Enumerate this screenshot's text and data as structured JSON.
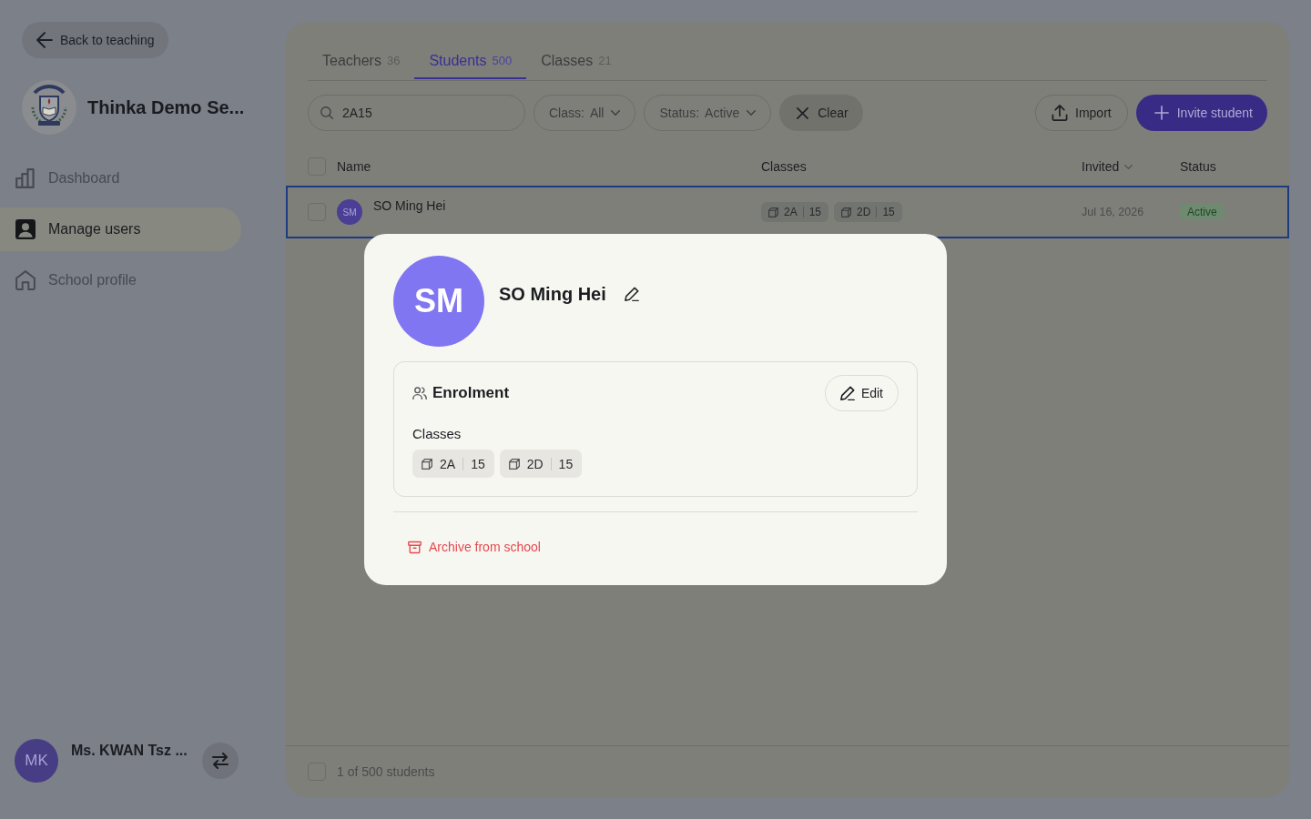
{
  "sidebar": {
    "back_button": "Back to teaching",
    "school_name": "Thinka Demo Se...",
    "nav_items": [
      {
        "label": "Dashboard",
        "selected": false
      },
      {
        "label": "Manage users",
        "selected": true
      },
      {
        "label": "School profile",
        "selected": false
      }
    ],
    "user": {
      "initials": "MK",
      "name": "Ms. KWAN Tsz ..."
    }
  },
  "tabs": [
    {
      "label": "Teachers",
      "count": "36",
      "selected": false
    },
    {
      "label": "Students",
      "count": "500",
      "selected": true
    },
    {
      "label": "Classes",
      "count": "21",
      "selected": false
    }
  ],
  "filters": {
    "search": {
      "value": "2A15"
    },
    "dropdowns": [
      {
        "label": "Class:",
        "value": "All"
      },
      {
        "label": "Status:",
        "value": "Active"
      }
    ],
    "clear_button": "Clear"
  },
  "actions": {
    "import_button": "Import",
    "invite_button": "Invite student"
  },
  "table": {
    "select_all": {
      "checked": false
    },
    "columns": [
      {
        "label": "Name",
        "sorted": false
      },
      {
        "label": "Classes",
        "sorted": false
      },
      {
        "label": "Invited",
        "sorted": true
      },
      {
        "label": "Status",
        "sorted": false
      }
    ],
    "rows": [
      {
        "initials": "SM",
        "name": "SO Ming Hei",
        "classes": [
          {
            "class_name": "2A",
            "number": "15"
          },
          {
            "class_name": "2D",
            "number": "15"
          }
        ],
        "invited": "Jul 16, 2026",
        "status": "Active",
        "selected": true,
        "checked": false
      }
    ]
  },
  "footer": {
    "count": "1 of 500 students",
    "checked": false
  },
  "modal": {
    "initials": "SM",
    "name": "SO Ming Hei",
    "section": {
      "title": "Enrolment",
      "edit_button": "Edit",
      "classes_label": "Classes",
      "classes": [
        {
          "class_name": "2A",
          "number": "15"
        },
        {
          "class_name": "2D",
          "number": "15"
        }
      ]
    },
    "archive_link": "Archive from school"
  }
}
